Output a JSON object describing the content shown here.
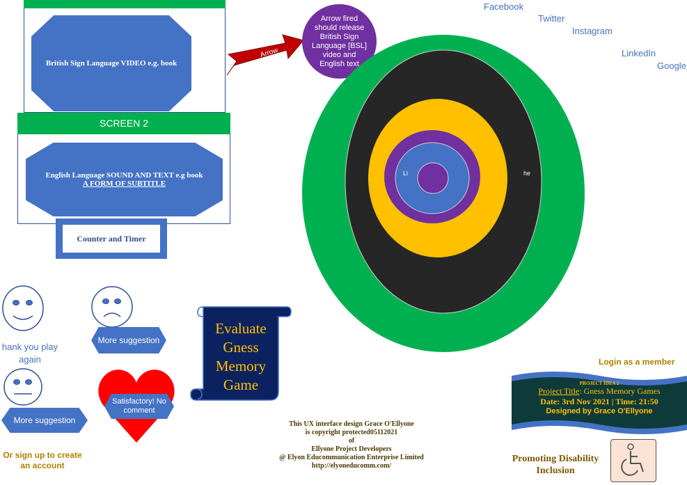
{
  "screen1": {
    "video_label": "British Sign Language VIDEO e.g. book"
  },
  "screen2": {
    "header": "SCREEN 2",
    "line1": "English Language SOUND AND TEXT e.g book",
    "line2": "A FORM OF SUBTITLE"
  },
  "counter_timer": "Counter and Timer",
  "arrow_label": "Arrow",
  "arrow_note": "Arrow fired should release British Sign Language [BSL] video and English text",
  "social": [
    "Facebook",
    "Twitter",
    "Instagram",
    "LinkedIn",
    "Google"
  ],
  "target": {
    "left_label": "Li",
    "right_label": "he"
  },
  "feedback": {
    "thank_you": "hank you play again",
    "more1": "More suggestion",
    "more2": "More suggestion",
    "satisfactory": "Satisfactory! No comment",
    "signup": "Or sign up to create an account"
  },
  "scroll_text": "Evaluate Gness Memory Game",
  "copyright": [
    "This UX interface design Grace O'Ellyone",
    "is copyright protected05112021",
    "of",
    "Ellyone Project Developers",
    "@ Elyon Educommunication Enterprise Limited",
    "http://elyoneducomm.com/"
  ],
  "login": "Login as a member",
  "banner": {
    "idea": "PROJECT IDEA 2",
    "title_label": "Project Title",
    "title_value": ": Gness Memory Games",
    "date": "Date: 3rd Nov 2021 | Time: 21:50",
    "designer": "Designed by Grace O'Ellyone"
  },
  "disability": "Promoting Disability Inclusion",
  "colors": {
    "blue": "#4472c4",
    "green": "#00b050",
    "purple": "#7030a0",
    "gold": "#ffc000",
    "dark": "#262626",
    "red": "#ff0000",
    "navy": "#0c2260"
  }
}
